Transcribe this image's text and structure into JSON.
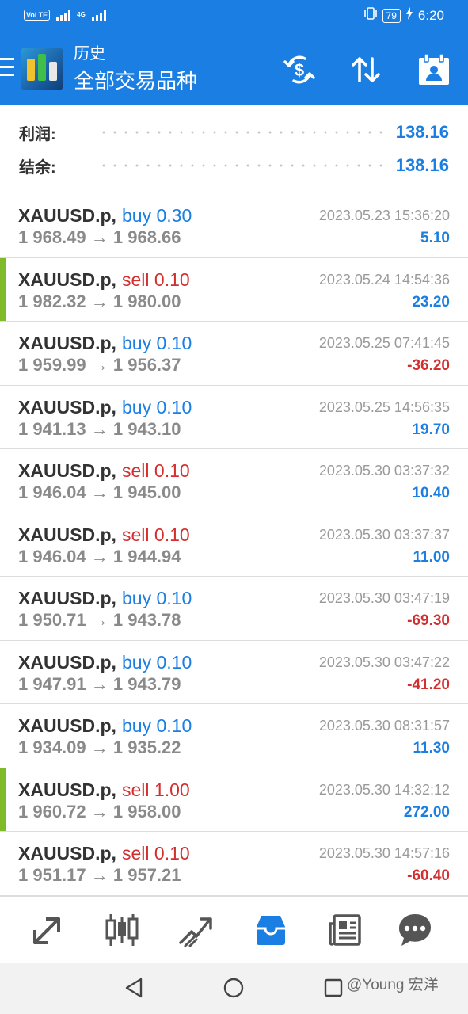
{
  "status_bar": {
    "volte": "VoLTE",
    "network": "4G",
    "battery": "79",
    "time": "6:20"
  },
  "app_bar": {
    "title": "历史",
    "subtitle": "全部交易品种"
  },
  "summary": {
    "profit_label": "利润:",
    "profit_value": "138.16",
    "balance_label": "结余:",
    "balance_value": "138.16"
  },
  "trades": [
    {
      "symbol": "XAUUSD.p,",
      "side": "buy",
      "volume": "0.30",
      "open": "1 968.49",
      "close": "1 968.66",
      "time": "2023.05.23 15:36:20",
      "profit": "5.10",
      "marked": false
    },
    {
      "symbol": "XAUUSD.p,",
      "side": "sell",
      "volume": "0.10",
      "open": "1 982.32",
      "close": "1 980.00",
      "time": "2023.05.24 14:54:36",
      "profit": "23.20",
      "marked": true
    },
    {
      "symbol": "XAUUSD.p,",
      "side": "buy",
      "volume": "0.10",
      "open": "1 959.99",
      "close": "1 956.37",
      "time": "2023.05.25 07:41:45",
      "profit": "-36.20",
      "marked": false
    },
    {
      "symbol": "XAUUSD.p,",
      "side": "buy",
      "volume": "0.10",
      "open": "1 941.13",
      "close": "1 943.10",
      "time": "2023.05.25 14:56:35",
      "profit": "19.70",
      "marked": false
    },
    {
      "symbol": "XAUUSD.p,",
      "side": "sell",
      "volume": "0.10",
      "open": "1 946.04",
      "close": "1 945.00",
      "time": "2023.05.30 03:37:32",
      "profit": "10.40",
      "marked": false
    },
    {
      "symbol": "XAUUSD.p,",
      "side": "sell",
      "volume": "0.10",
      "open": "1 946.04",
      "close": "1 944.94",
      "time": "2023.05.30 03:37:37",
      "profit": "11.00",
      "marked": false
    },
    {
      "symbol": "XAUUSD.p,",
      "side": "buy",
      "volume": "0.10",
      "open": "1 950.71",
      "close": "1 943.78",
      "time": "2023.05.30 03:47:19",
      "profit": "-69.30",
      "marked": false
    },
    {
      "symbol": "XAUUSD.p,",
      "side": "buy",
      "volume": "0.10",
      "open": "1 947.91",
      "close": "1 943.79",
      "time": "2023.05.30 03:47:22",
      "profit": "-41.20",
      "marked": false
    },
    {
      "symbol": "XAUUSD.p,",
      "side": "buy",
      "volume": "0.10",
      "open": "1 934.09",
      "close": "1 935.22",
      "time": "2023.05.30 08:31:57",
      "profit": "11.30",
      "marked": false
    },
    {
      "symbol": "XAUUSD.p,",
      "side": "sell",
      "volume": "1.00",
      "open": "1 960.72",
      "close": "1 958.00",
      "time": "2023.05.30 14:32:12",
      "profit": "272.00",
      "marked": true
    },
    {
      "symbol": "XAUUSD.p,",
      "side": "sell",
      "volume": "0.10",
      "open": "1 951.17",
      "close": "1 957.21",
      "time": "2023.05.30 14:57:16",
      "profit": "-60.40",
      "marked": false
    }
  ],
  "bottom_nav": [
    {
      "icon": "quotes-arrows-icon",
      "active": false
    },
    {
      "icon": "candlestick-chart-icon",
      "active": false
    },
    {
      "icon": "trade-trend-icon",
      "active": false
    },
    {
      "icon": "history-inbox-icon",
      "active": true
    },
    {
      "icon": "news-icon",
      "active": false
    },
    {
      "icon": "chat-icon",
      "active": false
    }
  ],
  "watermark": "@Young 宏洋",
  "colors": {
    "primary": "#1a7ee3",
    "sell": "#d32f2f",
    "marker": "#7fba2a"
  }
}
